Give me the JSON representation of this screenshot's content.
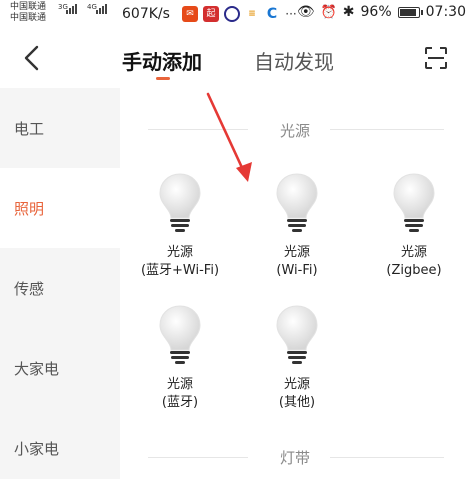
{
  "status_bar": {
    "carrier1": "中国联通",
    "carrier2": "中国联通",
    "net1": "3G",
    "net2": "4G",
    "speed": "607K/s",
    "battery": "96%",
    "time": "07:30"
  },
  "header": {
    "back_icon": "back-chevron-icon",
    "tab_manual": "手动添加",
    "tab_auto": "自动发现",
    "scan_icon": "scan-icon",
    "accent_color": "#e8643b"
  },
  "sidebar": {
    "items": [
      {
        "label": "电工",
        "active": false
      },
      {
        "label": "照明",
        "active": true
      },
      {
        "label": "传感",
        "active": false
      },
      {
        "label": "大家电",
        "active": false
      },
      {
        "label": "小家电",
        "active": false
      }
    ]
  },
  "sections": [
    {
      "title": "光源",
      "devices": [
        {
          "line1": "光源",
          "line2": "(蓝牙+Wi-Fi)"
        },
        {
          "line1": "光源",
          "line2": "(Wi-Fi)"
        },
        {
          "line1": "光源",
          "line2": "(Zigbee)"
        },
        {
          "line1": "光源",
          "line2": "(蓝牙)"
        },
        {
          "line1": "光源",
          "line2": "(其他)"
        }
      ]
    },
    {
      "title": "灯带",
      "devices": []
    }
  ]
}
